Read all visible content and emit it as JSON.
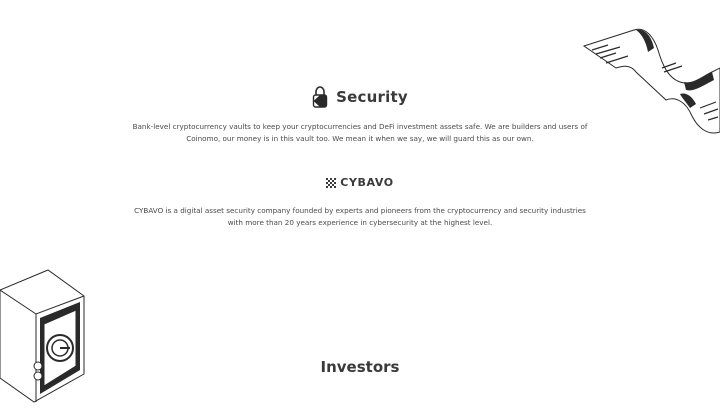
{
  "security": {
    "title": "Security",
    "icon": "padlock-icon",
    "description_line1": "Bank-level cryptocurrency vaults to keep your cryptocurrencies and DeFi investment assets safe. We are builders and users of",
    "description_line2": "Coinomo, our money is in this vault too. We mean it when we say, we will guard this as our own."
  },
  "partner": {
    "logo_text": "CYBAVO",
    "logo_icon": "dotted-square-icon",
    "description_line1": "CYBAVO is a digital asset security company founded by experts and pioneers from the cryptocurrency and security industries",
    "description_line2": "with more than 20 years experience in cybersecurity at the highest level."
  },
  "investors": {
    "title": "Investors"
  },
  "colors": {
    "text": "#333333",
    "background": "#ffffff"
  }
}
